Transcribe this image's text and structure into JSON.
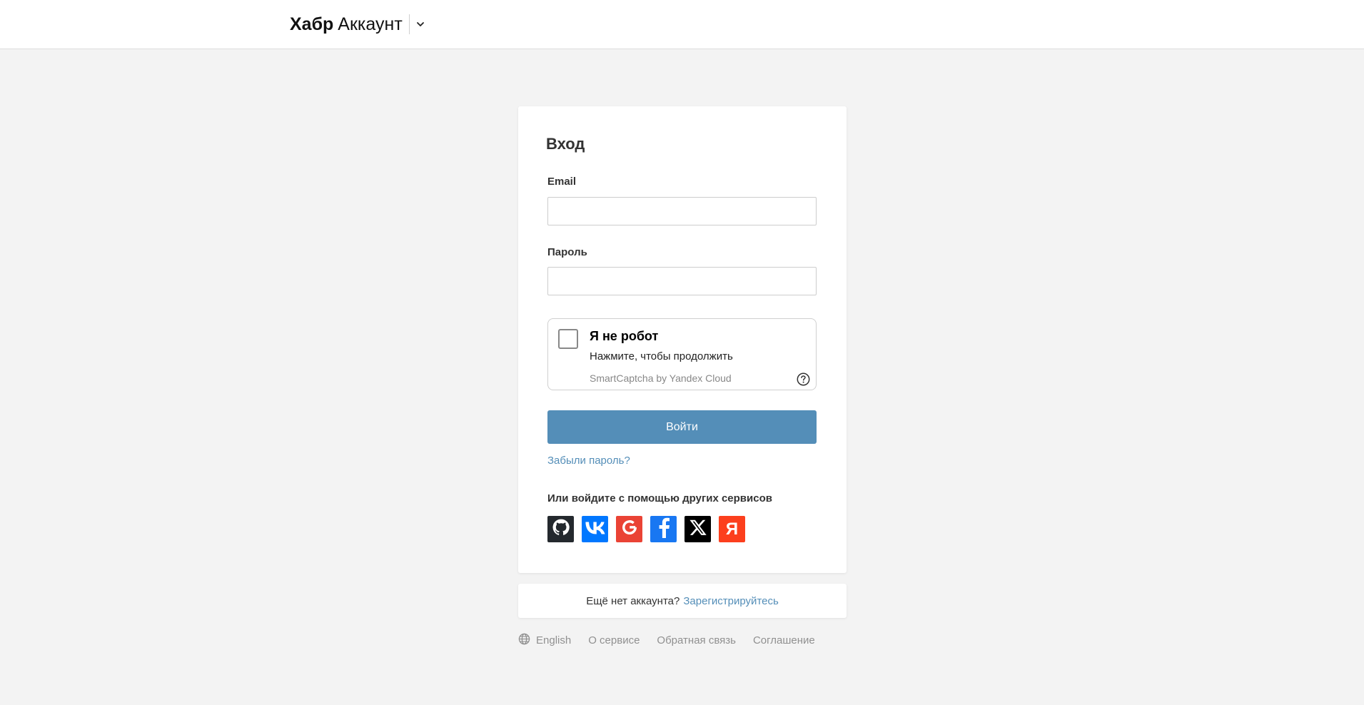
{
  "header": {
    "brand_bold": "Хабр",
    "brand_rest": "Аккаунт"
  },
  "login": {
    "title": "Вход",
    "email_label": "Email",
    "email_value": "",
    "password_label": "Пароль",
    "password_value": "",
    "captcha": {
      "title": "Я не робот",
      "subtitle": "Нажмите, чтобы продолжить",
      "brand": "SmartCaptcha by Yandex Cloud"
    },
    "submit_label": "Войти",
    "forgot_label": "Забыли пароль?",
    "other_services_label": "Или войдите с помощью других сервисов",
    "socials": [
      {
        "name": "github-icon",
        "color": "#24292e"
      },
      {
        "name": "vk-icon",
        "color": "#0077ff"
      },
      {
        "name": "google-icon",
        "color": "#ea4335"
      },
      {
        "name": "facebook-icon",
        "color": "#1877f2"
      },
      {
        "name": "x-icon",
        "color": "#000000"
      },
      {
        "name": "yandex-icon",
        "color": "#fc3f1d"
      }
    ]
  },
  "register": {
    "prompt": "Ещё нет аккаунта?",
    "link": "Зарегистрируйтесь"
  },
  "footer": {
    "language": "English",
    "about": "О сервисе",
    "feedback": "Обратная связь",
    "agreement": "Соглашение"
  },
  "colors": {
    "accent": "#548eb8",
    "background": "#f3f3f3"
  }
}
